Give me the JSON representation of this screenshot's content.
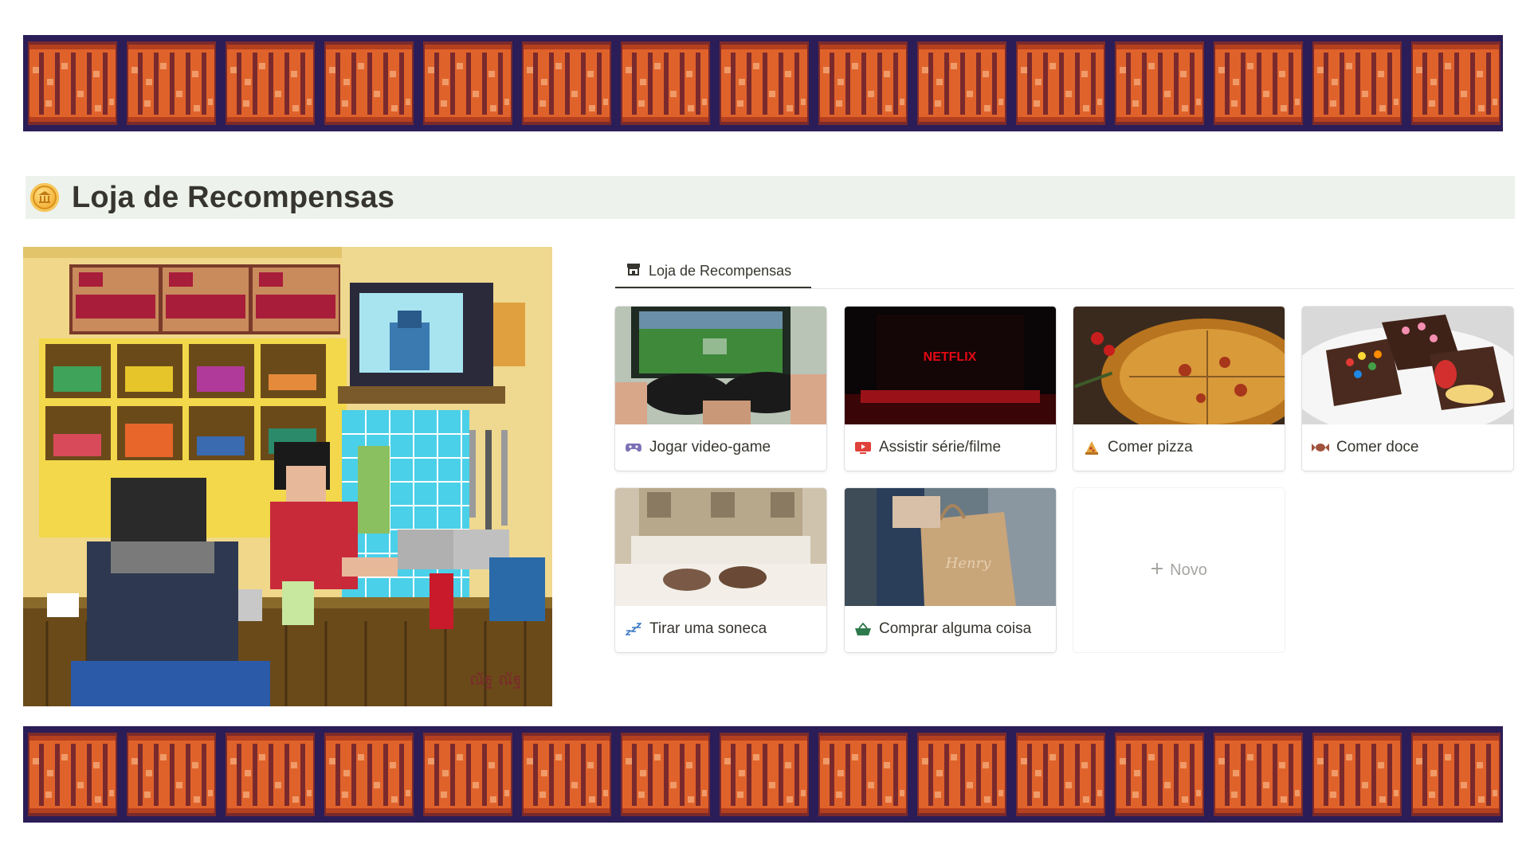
{
  "page": {
    "title": "Loja de Recompensas",
    "icon": "coin-icon"
  },
  "database": {
    "view_tab": "Loja de Recompensas",
    "view_icon": "store-icon",
    "new_label": "Novo",
    "cards": [
      {
        "title": "Jogar video-game",
        "icon": "gamepad-icon",
        "cover": "video-game-photo"
      },
      {
        "title": "Assistir série/filme",
        "icon": "youtube-play-icon",
        "cover": "netflix-screen-photo",
        "cover_text": "NETFLIX"
      },
      {
        "title": "Comer pizza",
        "icon": "pizza-icon",
        "cover": "pizza-photo"
      },
      {
        "title": "Comer doce",
        "icon": "candy-icon",
        "cover": "brownies-photo"
      },
      {
        "title": "Tirar uma soneca",
        "icon": "zzz-icon",
        "cover": "bed-photo"
      },
      {
        "title": "Comprar alguma coisa",
        "icon": "basket-icon",
        "cover": "shopping-bag-photo",
        "cover_text": "Henry"
      }
    ]
  },
  "art": {
    "signature": "ณัฐ ณัฐ"
  },
  "colors": {
    "banner_bg": "#2b1d57",
    "banner_orange": "#e0622b",
    "banner_dark_orange": "#b5401f",
    "heading_bg": "#edf2ec",
    "text": "#37352f"
  }
}
